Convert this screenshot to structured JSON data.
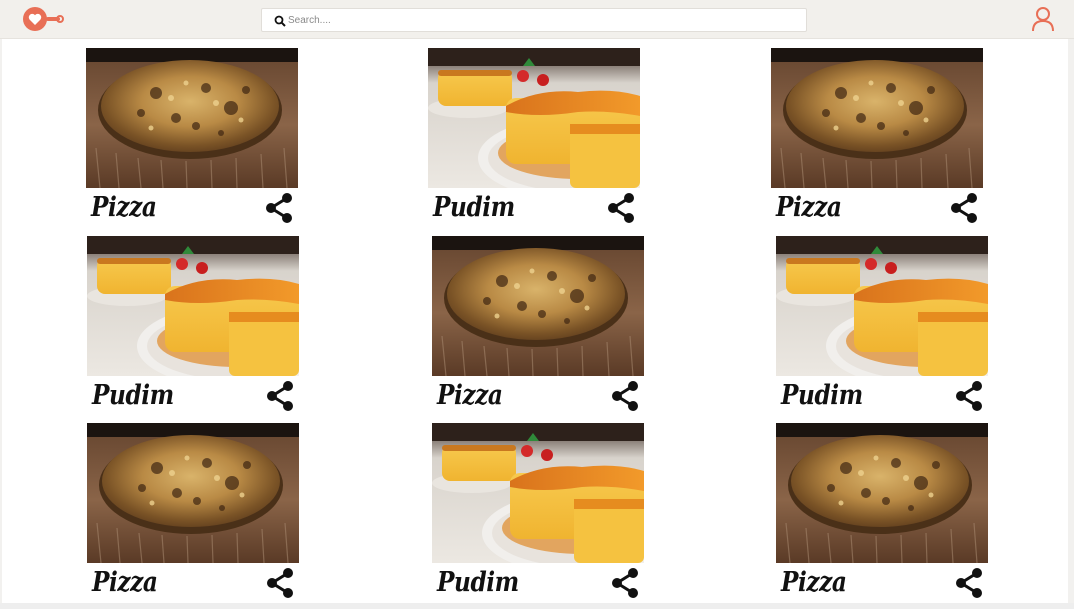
{
  "header": {
    "logo_icon": "heart-frying-pan-icon",
    "search_icon": "search-icon",
    "search_placeholder": "Search....",
    "search_value": "",
    "user_icon": "user-icon",
    "accent_color": "#e86f56"
  },
  "cards": [
    {
      "title": "Pizza",
      "image": "pizza-photo",
      "share_icon": "share-icon"
    },
    {
      "title": "Pudim",
      "image": "pudim-photo",
      "share_icon": "share-icon"
    },
    {
      "title": "Pizza",
      "image": "pizza-photo",
      "share_icon": "share-icon"
    },
    {
      "title": "Pudim",
      "image": "pudim-photo",
      "share_icon": "share-icon"
    },
    {
      "title": "Pizza",
      "image": "pizza-photo",
      "share_icon": "share-icon"
    },
    {
      "title": "Pudim",
      "image": "pudim-photo",
      "share_icon": "share-icon"
    },
    {
      "title": "Pizza",
      "image": "pizza-photo",
      "share_icon": "share-icon"
    },
    {
      "title": "Pudim",
      "image": "pudim-photo",
      "share_icon": "share-icon"
    },
    {
      "title": "Pizza",
      "image": "pizza-photo",
      "share_icon": "share-icon"
    }
  ]
}
